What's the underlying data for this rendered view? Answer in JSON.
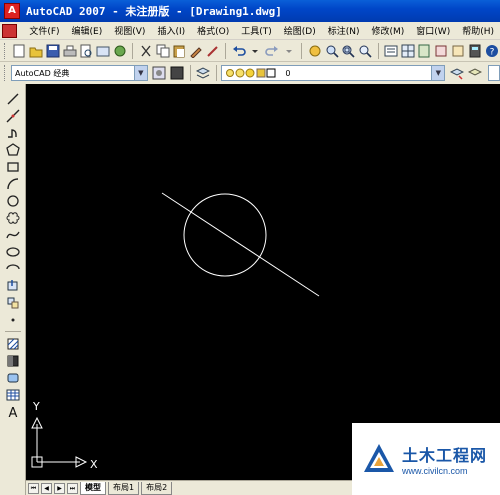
{
  "window": {
    "title": "AutoCAD 2007 - 未注册版 - [Drawing1.dwg]"
  },
  "menu": {
    "items": [
      "文件(F)",
      "编辑(E)",
      "视图(V)",
      "插入(I)",
      "格式(O)",
      "工具(T)",
      "绘图(D)",
      "标注(N)",
      "修改(M)",
      "窗口(W)",
      "帮助(H)"
    ]
  },
  "workspace": {
    "selected": "AutoCAD 经典"
  },
  "layer": {
    "current": "0"
  },
  "tabs": {
    "items": [
      "模型",
      "布局1",
      "布局2"
    ],
    "active": "模型"
  },
  "ucs": {
    "x_label": "X",
    "y_label": "Y"
  },
  "watermark": {
    "title": "土木工程网",
    "url": "www.civilcn.com"
  },
  "colors": {
    "canvas": "#000000",
    "geometry": "#ffffff",
    "titlebar": "#0a5fd8",
    "watermark_blue": "#1a57a8"
  }
}
